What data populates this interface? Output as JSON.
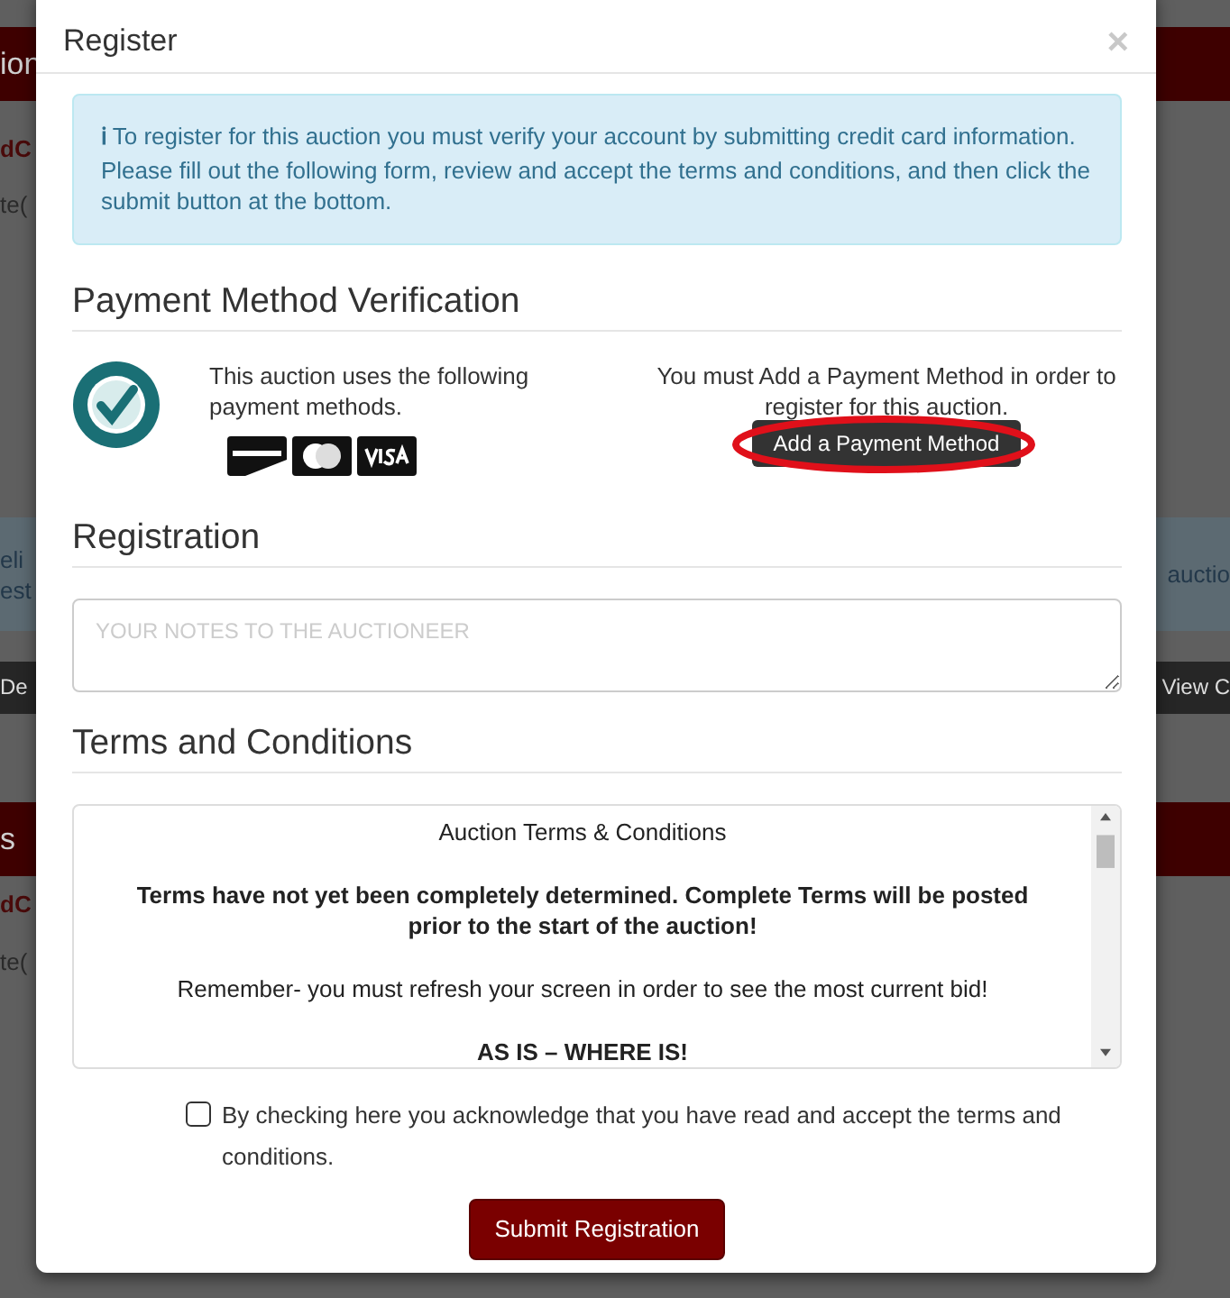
{
  "background_page": {
    "bands": [
      {
        "kind": "header",
        "left": [
          "ion"
        ]
      },
      {
        "kind": "link",
        "left": [
          "dC"
        ]
      },
      {
        "kind": "note",
        "left": [
          "te("
        ]
      },
      {
        "kind": "info",
        "left": [
          "eli",
          "est"
        ],
        "right": [
          "auctio"
        ]
      },
      {
        "kind": "toolbar",
        "left": [
          "De"
        ],
        "right": [
          "View C"
        ]
      },
      {
        "kind": "header",
        "left": [
          "s"
        ]
      },
      {
        "kind": "link",
        "left": [
          "dC"
        ]
      },
      {
        "kind": "note",
        "left": [
          "te("
        ]
      }
    ]
  },
  "modal": {
    "title": "Register",
    "close": "×",
    "alert": {
      "icon": "ℹ",
      "text": "To register for this auction you must verify your account by submitting credit card information. Please fill out the following form, review and accept the terms and conditions, and then click the submit button at the bottom."
    },
    "payment": {
      "heading": "Payment Method Verification",
      "methods_text": "This auction uses the following payment methods.",
      "cards": [
        {
          "kind": "discover"
        },
        {
          "kind": "mastercard"
        },
        {
          "kind": "visa"
        }
      ],
      "notice": "You must Add a Payment Method in order to register for this auction.",
      "button": {
        "label": "Add a Payment Method",
        "highlighted": true
      }
    },
    "registration": {
      "heading": "Registration",
      "notes": {
        "placeholder": "YOUR NOTES TO THE AUCTIONEER"
      }
    },
    "terms": {
      "heading": "Terms and Conditions",
      "paragraphs": [
        {
          "kind": "title",
          "text": "Auction Terms & Conditions"
        },
        {
          "kind": "bold",
          "text": "Terms have not yet been completely determined. Complete Terms will be posted prior to the start of the auction!"
        },
        {
          "kind": "plain",
          "text": "Remember- you must refresh your screen in order to see the most current bid!"
        },
        {
          "kind": "bold",
          "text": "AS IS – WHERE IS!"
        }
      ],
      "accept": {
        "label": "By checking here you acknowledge that you have read and accept the terms and conditions.",
        "checked": false
      }
    },
    "submit": "Submit Registration"
  }
}
